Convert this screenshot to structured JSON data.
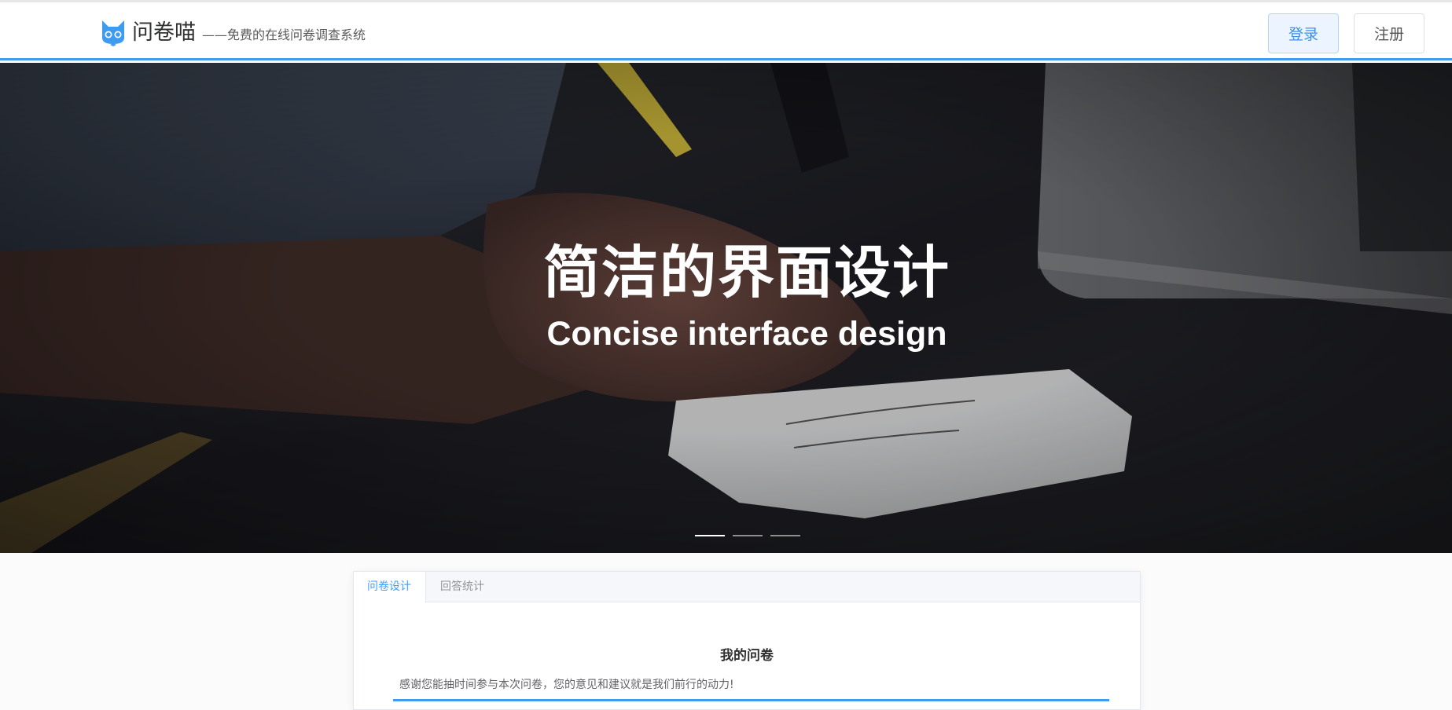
{
  "header": {
    "brand": "问卷喵",
    "slogan": "——免费的在线问卷调查系统",
    "login_label": "登录",
    "register_label": "注册"
  },
  "hero": {
    "title": "简洁的界面设计",
    "subtitle": "Concise interface design",
    "active_slide": 1,
    "slide_count": 3
  },
  "tabs": [
    {
      "label": "问卷设计",
      "active": true
    },
    {
      "label": "回答统计",
      "active": false
    }
  ],
  "survey": {
    "title": "我的问卷",
    "description": "感谢您能抽时间参与本次问卷，您的意见和建议就是我们前行的动力!"
  },
  "colors": {
    "accent": "#3e9bee",
    "tab_active": "#409eff"
  }
}
